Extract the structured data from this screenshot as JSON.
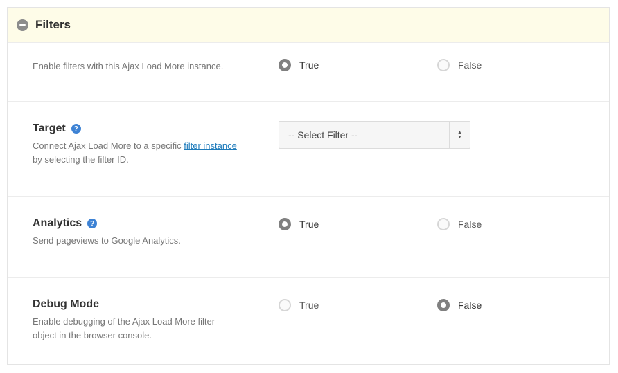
{
  "panel": {
    "title": "Filters",
    "expanded": true
  },
  "settings": [
    {
      "description": "Enable filters with this Ajax Load More instance.",
      "options": [
        {
          "label": "True",
          "checked": true
        },
        {
          "label": "False",
          "checked": false
        }
      ]
    },
    {
      "title": "Target",
      "description_before": "Connect Ajax Load More to a specific ",
      "link_text": "filter instance",
      "description_after": "by selecting the filter ID.",
      "select": {
        "selected": "-- Select Filter --"
      }
    },
    {
      "title": "Analytics",
      "description": "Send pageviews to Google Analytics.",
      "options": [
        {
          "label": "True",
          "checked": true
        },
        {
          "label": "False",
          "checked": false
        }
      ]
    },
    {
      "title": "Debug Mode",
      "description_line1": "Enable debugging of the Ajax Load More filter",
      "description_line2": "object in the browser console.",
      "options": [
        {
          "label": "True",
          "checked": false
        },
        {
          "label": "False",
          "checked": true
        }
      ]
    }
  ],
  "icons": {
    "help": "?"
  },
  "colors": {
    "header_bg": "#fefce8",
    "help_icon": "#3d82d4",
    "link": "#1e7bbb"
  }
}
